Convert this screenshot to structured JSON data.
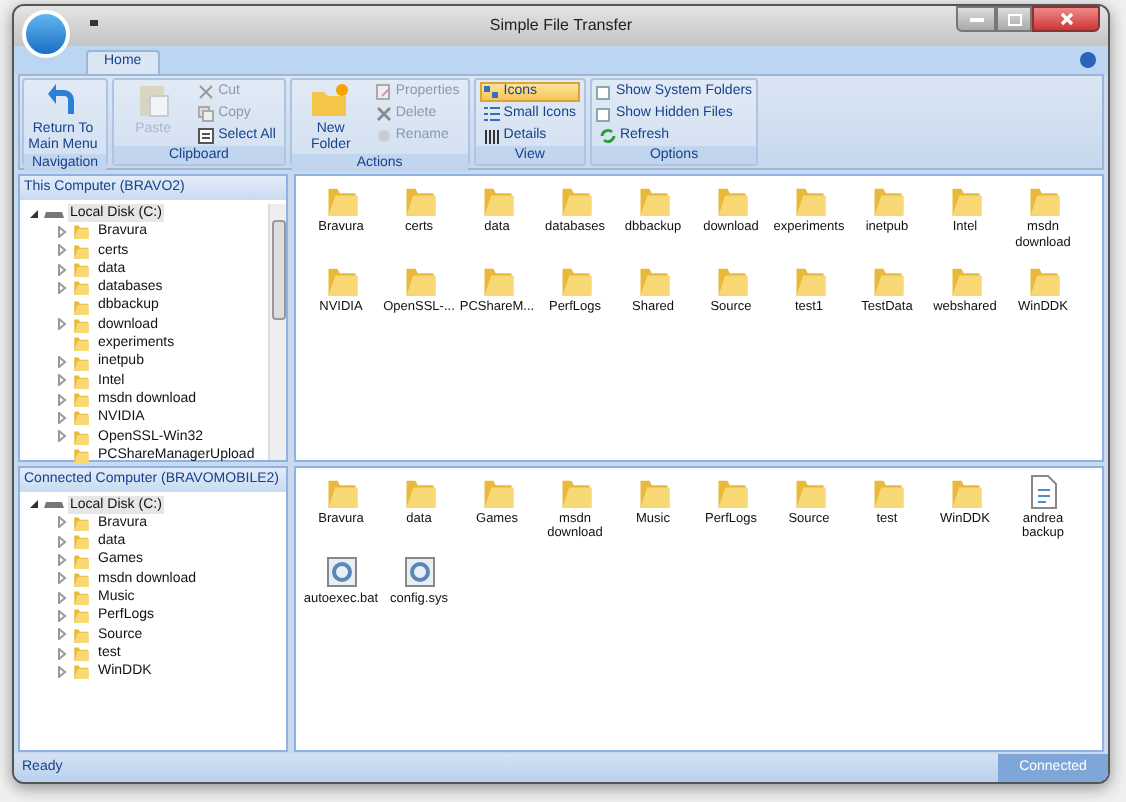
{
  "window": {
    "title": "Simple File Transfer"
  },
  "tabs": [
    {
      "label": "Home",
      "selected": true
    }
  ],
  "ribbon": [
    {
      "label": "Navigation",
      "items": [
        {
          "kind": "large",
          "label": "Return To Main Menu",
          "disabled": false
        }
      ]
    },
    {
      "label": "Clipboard",
      "items": [
        {
          "kind": "large",
          "label": "Paste",
          "disabled": true
        },
        {
          "kind": "small",
          "label": "Cut",
          "disabled": true
        },
        {
          "kind": "small",
          "label": "Copy",
          "disabled": true
        },
        {
          "kind": "small",
          "label": "Select All",
          "disabled": false
        }
      ]
    },
    {
      "label": "Actions",
      "items": [
        {
          "kind": "large",
          "label": "New Folder",
          "disabled": false
        },
        {
          "kind": "small",
          "label": "Properties",
          "disabled": true
        },
        {
          "kind": "small",
          "label": "Delete",
          "disabled": true
        },
        {
          "kind": "small",
          "label": "Rename",
          "disabled": true
        }
      ]
    },
    {
      "label": "View",
      "items": [
        {
          "kind": "small",
          "label": "Icons",
          "selected": true
        },
        {
          "kind": "small",
          "label": "Small Icons",
          "selected": false
        },
        {
          "kind": "small",
          "label": "Details",
          "selected": false
        }
      ]
    },
    {
      "label": "Options",
      "items": [
        {
          "kind": "checkbox",
          "label": "Show System Folders",
          "checked": false
        },
        {
          "kind": "checkbox",
          "label": "Show Hidden Files",
          "checked": false
        },
        {
          "kind": "small",
          "label": "Refresh",
          "disabled": false
        }
      ]
    }
  ],
  "panes": [
    {
      "header": "This Computer (BRAVO2)",
      "tree": {
        "label": "Local Disk (C:)",
        "expanded": true,
        "selected": true,
        "children": [
          {
            "label": "Bravura",
            "expandable": true,
            "selected": false
          },
          {
            "label": "certs",
            "expandable": true,
            "selected": false
          },
          {
            "label": "data",
            "expandable": true,
            "selected": false
          },
          {
            "label": "databases",
            "expandable": true,
            "selected": false
          },
          {
            "label": "dbbackup",
            "expandable": false,
            "selected": false
          },
          {
            "label": "download",
            "expandable": true,
            "selected": false
          },
          {
            "label": "experiments",
            "expandable": false,
            "selected": false
          },
          {
            "label": "inetpub",
            "expandable": true,
            "selected": false
          },
          {
            "label": "Intel",
            "expandable": true,
            "selected": false
          },
          {
            "label": "msdn download",
            "expandable": true,
            "selected": false
          },
          {
            "label": "NVIDIA",
            "expandable": true,
            "selected": false
          },
          {
            "label": "OpenSSL-Win32",
            "expandable": true,
            "selected": false
          },
          {
            "label": "PCShareManagerUpload",
            "expandable": false,
            "selected": false
          }
        ]
      },
      "files": [
        {
          "kind": "folder",
          "label": "Bravura"
        },
        {
          "kind": "folder",
          "label": "certs"
        },
        {
          "kind": "folder",
          "label": "data"
        },
        {
          "kind": "folder",
          "label": "databases"
        },
        {
          "kind": "folder",
          "label": "dbbackup"
        },
        {
          "kind": "folder",
          "label": "download"
        },
        {
          "kind": "folder",
          "label": "experiments"
        },
        {
          "kind": "folder",
          "label": "inetpub"
        },
        {
          "kind": "folder",
          "label": "Intel"
        },
        {
          "kind": "folder",
          "label": "msdn download"
        },
        {
          "kind": "folder",
          "label": "NVIDIA"
        },
        {
          "kind": "folder",
          "label": "OpenSSL-..."
        },
        {
          "kind": "folder",
          "label": "PCShareM..."
        },
        {
          "kind": "folder",
          "label": "PerfLogs"
        },
        {
          "kind": "folder",
          "label": "Shared"
        },
        {
          "kind": "folder",
          "label": "Source"
        },
        {
          "kind": "folder",
          "label": "test1"
        },
        {
          "kind": "folder",
          "label": "TestData"
        },
        {
          "kind": "folder",
          "label": "webshared"
        },
        {
          "kind": "folder",
          "label": "WinDDK"
        }
      ]
    },
    {
      "header": "Connected Computer (BRAVOMOBILE2)",
      "tree": {
        "label": "Local Disk (C:)",
        "expanded": true,
        "selected": true,
        "children": [
          {
            "label": "Bravura",
            "expandable": true,
            "selected": false
          },
          {
            "label": "data",
            "expandable": true,
            "selected": false
          },
          {
            "label": "Games",
            "expandable": true,
            "selected": false
          },
          {
            "label": "msdn download",
            "expandable": true,
            "selected": false
          },
          {
            "label": "Music",
            "expandable": true,
            "selected": false
          },
          {
            "label": "PerfLogs",
            "expandable": true,
            "selected": false
          },
          {
            "label": "Source",
            "expandable": true,
            "selected": false
          },
          {
            "label": "test",
            "expandable": true,
            "selected": false
          },
          {
            "label": "WinDDK",
            "expandable": true,
            "selected": false
          }
        ]
      },
      "files": [
        {
          "kind": "folder",
          "label": "Bravura"
        },
        {
          "kind": "folder",
          "label": "data"
        },
        {
          "kind": "folder",
          "label": "Games"
        },
        {
          "kind": "folder",
          "label": "msdn download"
        },
        {
          "kind": "folder",
          "label": "Music"
        },
        {
          "kind": "folder",
          "label": "PerfLogs"
        },
        {
          "kind": "folder",
          "label": "Source"
        },
        {
          "kind": "folder",
          "label": "test"
        },
        {
          "kind": "folder",
          "label": "WinDDK"
        },
        {
          "kind": "document",
          "label": "andrea backup"
        },
        {
          "kind": "system",
          "label": "autoexec.bat"
        },
        {
          "kind": "system",
          "label": "config.sys"
        }
      ]
    }
  ],
  "status_bar": {
    "left": "Ready",
    "right": "Connected"
  }
}
